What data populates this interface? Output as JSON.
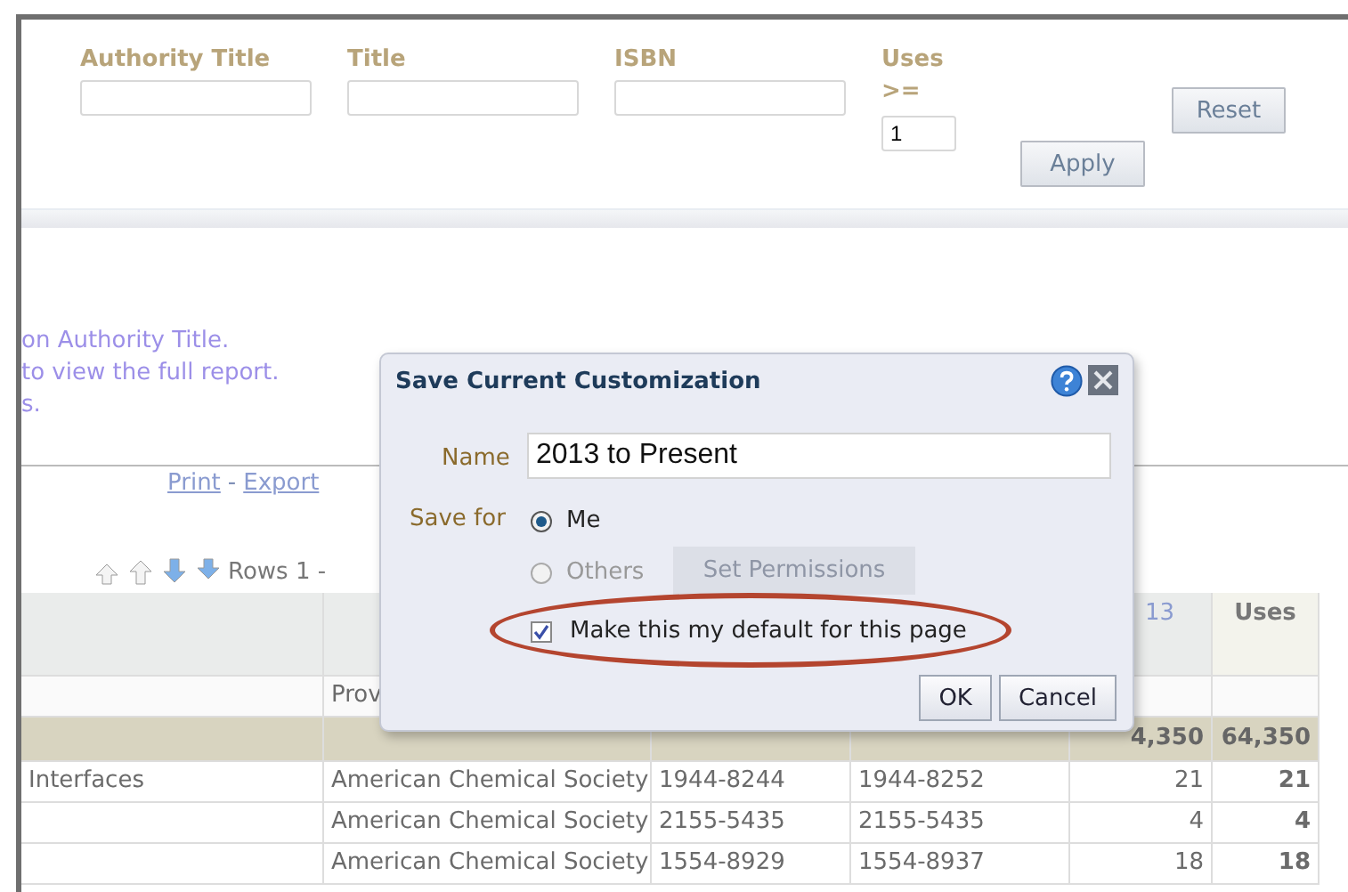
{
  "filters": {
    "fields": [
      {
        "label": "Authority Title"
      },
      {
        "label": "Title"
      },
      {
        "label": "ISBN"
      }
    ],
    "uses": {
      "label": "Uses >=",
      "value": "1"
    },
    "apply_button": "Apply",
    "reset_button": "Reset"
  },
  "info_lines": [
    "on Authority Title.",
    "to view the full report.",
    "s."
  ],
  "links": [
    "Print",
    "Export"
  ],
  "link_separator": "-",
  "pagination": {
    "label": "Rows 1 -"
  },
  "table": {
    "header": {
      "column_5": "13",
      "column_6": "Uses"
    },
    "subheader": {
      "column_2": "Prov"
    },
    "total_row": {
      "column_5": "4,350",
      "column_6": "64,350"
    },
    "rows": [
      {
        "column_1": "Interfaces",
        "column_2": "American Chemical Society",
        "column_3": "1944-8244",
        "column_4": "1944-8252",
        "column_5": "21",
        "column_6": "21"
      },
      {
        "column_2": "American Chemical Society",
        "column_3": "2155-5435",
        "column_4": "2155-5435",
        "column_5": "4",
        "column_6": "4"
      },
      {
        "column_2": "American Chemical Society",
        "column_3": "1554-8929",
        "column_4": "1554-8937",
        "column_5": "18",
        "column_6": "18"
      }
    ]
  },
  "dialog": {
    "title": "Save Current Customization",
    "name_label": "Name",
    "name_value": "2013 to Present",
    "save_for_label": "Save for",
    "options": [
      {
        "label": "Me",
        "selected": true,
        "disabled": false
      },
      {
        "label": "Others",
        "selected": false,
        "disabled": true
      }
    ],
    "permissions_button": "Set Permissions",
    "default_checkbox": {
      "label": "Make this my default for this page",
      "checked": true
    },
    "buttons": [
      "OK",
      "Cancel"
    ]
  }
}
